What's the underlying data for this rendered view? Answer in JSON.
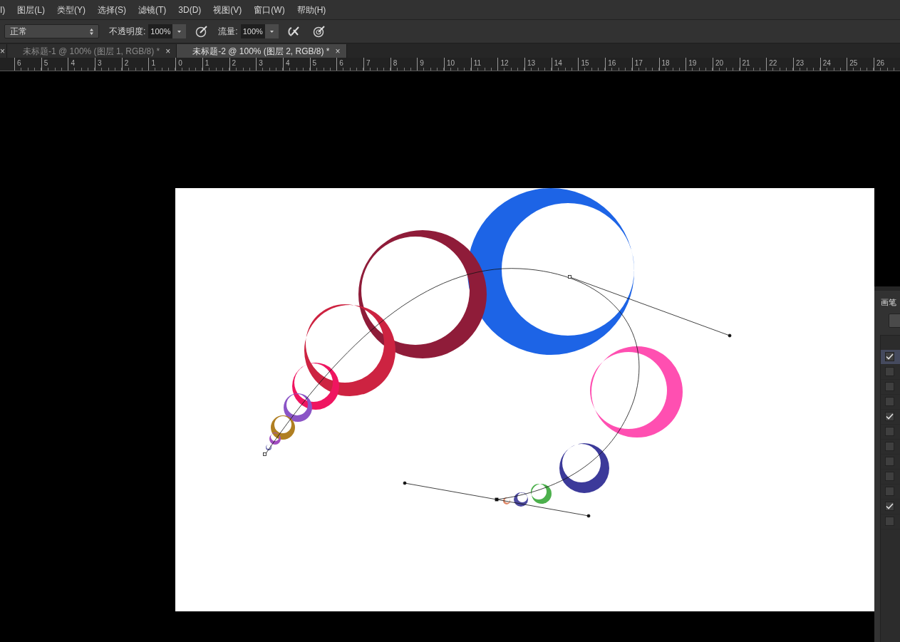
{
  "menu_bar": {
    "items": [
      "I)",
      "图层(L)",
      "类型(Y)",
      "选择(S)",
      "滤镜(T)",
      "3D(D)",
      "视图(V)",
      "窗口(W)",
      "帮助(H)"
    ]
  },
  "options_bar": {
    "mode": "正常",
    "opacity_label": "不透明度:",
    "opacity": "100%",
    "flow_label": "流量:",
    "flow": "100%"
  },
  "tabs": [
    {
      "close": "×",
      "selected": false
    },
    {
      "label": "未标题-1 @ 100% (图层 1, RGB/8) *",
      "close": "×",
      "selected": false
    },
    {
      "label": "未标题-2 @ 100% (图层 2, RGB/8) *",
      "close": "×",
      "selected": true
    }
  ],
  "ruler": {
    "labels": [
      "6",
      "5",
      "4",
      "3",
      "2",
      "1",
      "0",
      "1",
      "2",
      "3",
      "4",
      "5",
      "6",
      "7",
      "8",
      "9",
      "10",
      "11",
      "12",
      "13",
      "14",
      "15",
      "16",
      "17",
      "18",
      "19",
      "20",
      "21",
      "22",
      "23",
      "24",
      "25",
      "26"
    ]
  },
  "brush_panel": {
    "title": "画笔",
    "options": [
      {
        "checked": true,
        "selected": true
      },
      {
        "checked": false,
        "selected": false
      },
      {
        "checked": false,
        "selected": false
      },
      {
        "checked": false,
        "selected": false
      },
      {
        "checked": true,
        "selected": false
      },
      {
        "checked": false,
        "selected": false
      },
      {
        "checked": false,
        "selected": false
      },
      {
        "checked": false,
        "selected": false
      },
      {
        "checked": false,
        "selected": false
      },
      {
        "checked": false,
        "selected": false
      },
      {
        "checked": true,
        "selected": false
      },
      {
        "checked": false,
        "selected": false
      }
    ]
  }
}
